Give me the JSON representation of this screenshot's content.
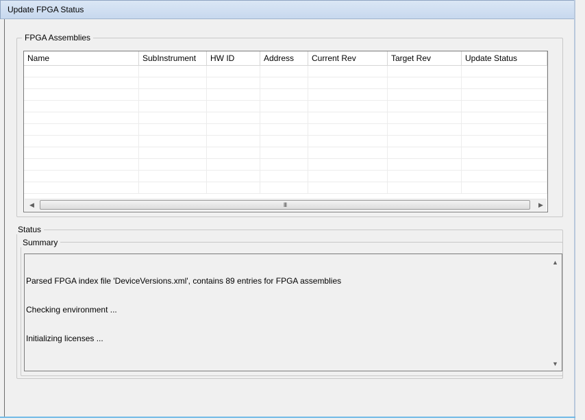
{
  "window": {
    "title": "Update FPGA Status"
  },
  "assemblies": {
    "legend": "FPGA Assemblies",
    "columns": [
      {
        "label": "Name"
      },
      {
        "label": "SubInstrument"
      },
      {
        "label": "HW ID"
      },
      {
        "label": "Address"
      },
      {
        "label": "Current Rev"
      },
      {
        "label": "Target Rev"
      },
      {
        "label": "Update Status"
      }
    ],
    "empty_row_count": 11,
    "hscroll_thumb_glyph": "III"
  },
  "status": {
    "legend": "Status",
    "summary": {
      "legend": "Summary",
      "lines": [
        "Parsed FPGA index file 'DeviceVersions.xml', contains 89 entries for FPGA assemblies",
        "Checking environment ...",
        "Initializing licenses ..."
      ]
    }
  },
  "icons": {
    "left_arrow": "triangle-left",
    "right_arrow": "triangle-right",
    "up_arrow": "triangle-up",
    "down_arrow": "triangle-down"
  }
}
